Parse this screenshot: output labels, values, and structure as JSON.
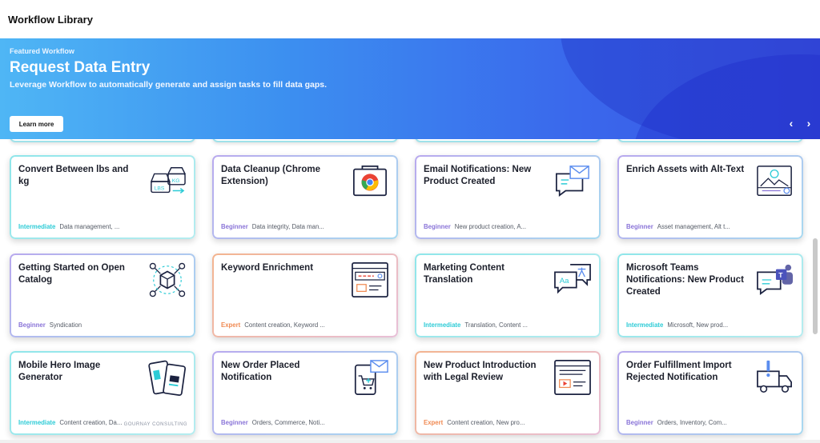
{
  "app": {
    "title": "Workflow Library"
  },
  "hero": {
    "kicker": "Featured Workflow",
    "headline": "Request Data Entry",
    "subtitle": "Leverage Workflow to automatically generate and assign tasks to fill data gaps.",
    "cta": "Learn more",
    "prev_icon": "chevron-left-icon",
    "next_icon": "chevron-right-icon",
    "prev_glyph": "‹",
    "next_glyph": "›"
  },
  "cards": [
    {
      "title": "Convert Between lbs and kg",
      "level": "Intermediate",
      "tags": "Data management, ...",
      "icon": "weights-icon"
    },
    {
      "title": "Data Cleanup (Chrome Extension)",
      "level": "Beginner",
      "tags": "Data integrity, Data man...",
      "icon": "chrome-icon"
    },
    {
      "title": "Email Notifications: New Product Created",
      "level": "Beginner",
      "tags": "New product creation, A...",
      "icon": "email-chat-icon"
    },
    {
      "title": "Enrich Assets with Alt-Text",
      "level": "Beginner",
      "tags": "Asset management, Alt t...",
      "icon": "image-search-icon"
    },
    {
      "title": "Getting Started on Open Catalog",
      "level": "Beginner",
      "tags": "Syndication",
      "icon": "network-box-icon"
    },
    {
      "title": "Keyword Enrichment",
      "level": "Expert",
      "tags": "Content creation, Keyword ...",
      "icon": "browser-search-icon"
    },
    {
      "title": "Marketing Content Translation",
      "level": "Intermediate",
      "tags": "Translation, Content ...",
      "icon": "translate-icon"
    },
    {
      "title": "Microsoft Teams Notifications: New Product Created",
      "level": "Intermediate",
      "tags": "Microsoft, New prod...",
      "icon": "teams-icon"
    },
    {
      "title": "Mobile Hero Image Generator",
      "level": "Intermediate",
      "tags": "Content creation, Da...",
      "icon": "mobile-products-icon",
      "partner": "GOURNAY CONSULTING"
    },
    {
      "title": "New Order Placed Notification",
      "level": "Beginner",
      "tags": "Orders, Commerce, Noti...",
      "icon": "mobile-cart-icon"
    },
    {
      "title": "New Product Introduction with Legal Review",
      "level": "Expert",
      "tags": "Content creation, New pro...",
      "icon": "browser-video-icon"
    },
    {
      "title": "Order Fulfillment Import Rejected Notification",
      "level": "Beginner",
      "tags": "Orders, Inventory, Com...",
      "icon": "truck-alert-icon"
    }
  ],
  "colors": {
    "Intermediate": "#2ccbd6",
    "Beginner": "#8a74d8",
    "Expert": "#f08a52"
  }
}
